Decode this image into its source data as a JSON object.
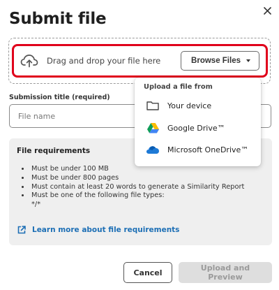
{
  "dialog": {
    "title": "Submit file"
  },
  "dropzone": {
    "text": "Drag and drop your file here",
    "browse_label": "Browse Files"
  },
  "submission": {
    "label": "Submission title (required)",
    "placeholder": "File name"
  },
  "requirements": {
    "title": "File requirements",
    "items": [
      "Must be under 100 MB",
      "Must be under 800 pages",
      "Must contain at least 20 words to generate a Similarity Report",
      "Must be one of the following file types:"
    ],
    "file_types": "*/*",
    "link_label": "Learn more about file requirements"
  },
  "menu": {
    "header": "Upload a file from",
    "items": [
      {
        "label": "Your device",
        "icon": "folder-icon"
      },
      {
        "label": "Google Drive™",
        "icon": "google-drive-icon"
      },
      {
        "label": "Microsoft OneDrive™",
        "icon": "onedrive-icon"
      }
    ]
  },
  "footer": {
    "cancel_label": "Cancel",
    "upload_label": "Upload and Preview"
  },
  "colors": {
    "highlight": "#e0001b",
    "link": "#1d6fb5",
    "requirements_bg": "#efefef"
  }
}
